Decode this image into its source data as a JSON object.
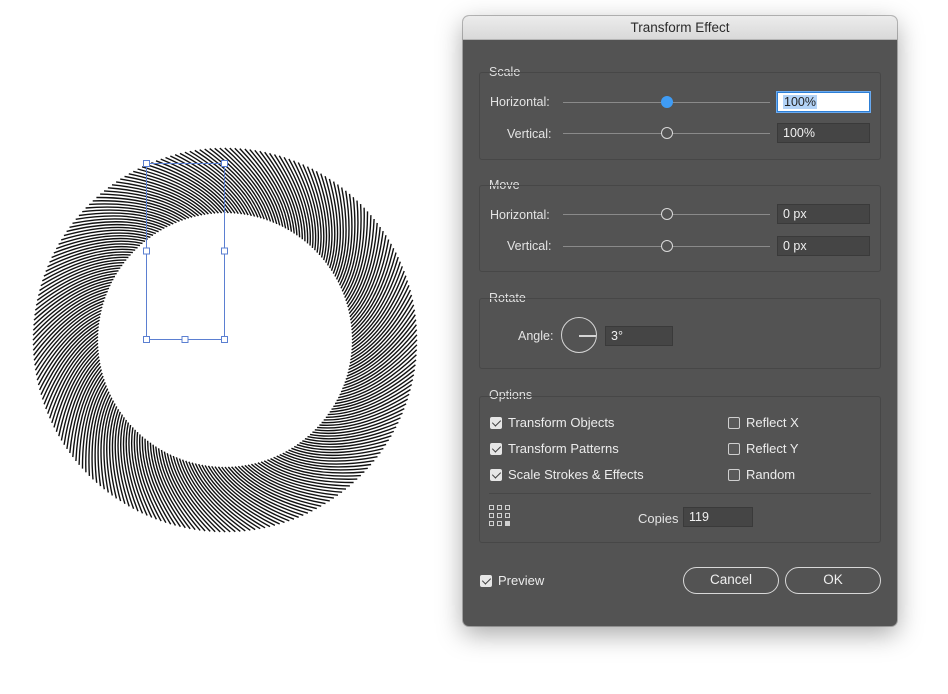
{
  "dialog": {
    "title": "Transform Effect",
    "scale": {
      "title": "Scale",
      "horizontal_label": "Horizontal:",
      "horizontal_value": "100%",
      "vertical_label": "Vertical:",
      "vertical_value": "100%"
    },
    "move": {
      "title": "Move",
      "horizontal_label": "Horizontal:",
      "horizontal_value": "0 px",
      "vertical_label": "Vertical:",
      "vertical_value": "0 px"
    },
    "rotate": {
      "title": "Rotate",
      "angle_label": "Angle:",
      "angle_value": "3°"
    },
    "options": {
      "title": "Options",
      "transform_objects": "Transform Objects",
      "transform_patterns": "Transform Patterns",
      "scale_strokes": "Scale Strokes & Effects",
      "reflect_x": "Reflect X",
      "reflect_y": "Reflect Y",
      "random": "Random",
      "copies_label": "Copies",
      "copies_value": "119"
    },
    "preview_label": "Preview",
    "cancel_label": "Cancel",
    "ok_label": "OK"
  },
  "colors": {
    "dialog_bg": "#535353",
    "accent": "#3f9cf5",
    "selection_blue": "#5b7fd1"
  }
}
